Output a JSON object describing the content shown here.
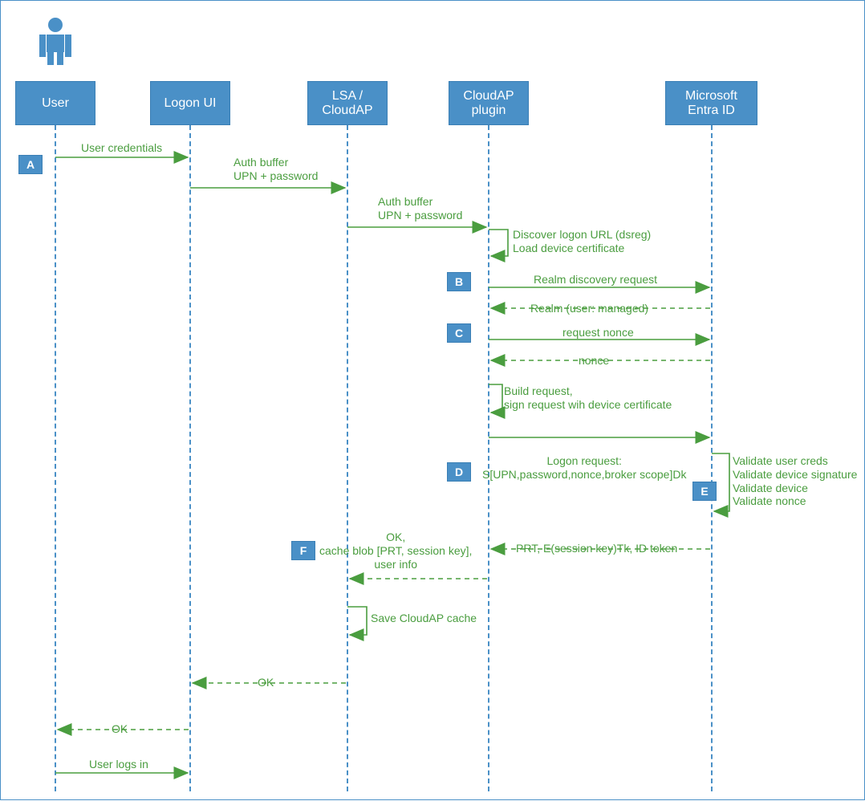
{
  "participants": {
    "user": "User",
    "logonui": "Logon UI",
    "lsa": "LSA / CloudAP",
    "plugin": "CloudAP plugin",
    "entra": "Microsoft Entra ID"
  },
  "steps": {
    "A": "A",
    "B": "B",
    "C": "C",
    "D": "D",
    "E": "E",
    "F": "F"
  },
  "messages": {
    "user_creds": "User credentials",
    "auth_buffer1": "Auth buffer\nUPN + password",
    "auth_buffer2": "Auth buffer\nUPN + password",
    "discover": "Discover logon URL (dsreg)\nLoad device certificate",
    "realm_req": "Realm discovery request",
    "realm_resp": "Realm (user: managed)",
    "req_nonce": "request nonce",
    "nonce": "nonce",
    "build_sign": "Build request,\nsign request wih device certificate",
    "logon_req": "Logon request:\nS[UPN,password,nonce,broker scope]Dk",
    "validate": "Validate user creds\nValidate device signature\nValidate device\nValidate nonce",
    "prt_resp": "PRT, E(session key)Tk, ID token",
    "cache_blob": "OK,\ncache blob [PRT, session key],\nuser info",
    "save_cache": "Save CloudAP cache",
    "ok1": "OK",
    "ok2": "OK",
    "logs_in": "User logs in"
  },
  "colors": {
    "blue": "#4a90c7",
    "green": "#4a9d3f"
  },
  "chart_data": {
    "type": "sequence-diagram",
    "participants": [
      "User",
      "Logon UI",
      "LSA / CloudAP",
      "CloudAP plugin",
      "Microsoft Entra ID"
    ],
    "steps": [
      {
        "tag": "A",
        "from": "User",
        "to": "Logon UI",
        "label": "User credentials",
        "style": "solid"
      },
      {
        "from": "Logon UI",
        "to": "LSA / CloudAP",
        "label": "Auth buffer UPN + password",
        "style": "solid"
      },
      {
        "from": "LSA / CloudAP",
        "to": "CloudAP plugin",
        "label": "Auth buffer UPN + password",
        "style": "solid"
      },
      {
        "from": "CloudAP plugin",
        "to": "CloudAP plugin",
        "label": "Discover logon URL (dsreg); Load device certificate",
        "style": "self"
      },
      {
        "tag": "B",
        "from": "CloudAP plugin",
        "to": "Microsoft Entra ID",
        "label": "Realm discovery request",
        "style": "solid"
      },
      {
        "from": "Microsoft Entra ID",
        "to": "CloudAP plugin",
        "label": "Realm (user: managed)",
        "style": "dashed"
      },
      {
        "tag": "C",
        "from": "CloudAP plugin",
        "to": "Microsoft Entra ID",
        "label": "request nonce",
        "style": "solid"
      },
      {
        "from": "Microsoft Entra ID",
        "to": "CloudAP plugin",
        "label": "nonce",
        "style": "dashed"
      },
      {
        "from": "CloudAP plugin",
        "to": "CloudAP plugin",
        "label": "Build request, sign request wih device certificate",
        "style": "self"
      },
      {
        "tag": "D",
        "from": "CloudAP plugin",
        "to": "Microsoft Entra ID",
        "label": "Logon request: S[UPN,password,nonce,broker scope]Dk",
        "style": "solid"
      },
      {
        "tag": "E",
        "from": "Microsoft Entra ID",
        "to": "Microsoft Entra ID",
        "label": "Validate user creds; Validate device signature; Validate device; Validate nonce",
        "style": "self"
      },
      {
        "from": "Microsoft Entra ID",
        "to": "CloudAP plugin",
        "label": "PRT, E(session key)Tk, ID token",
        "style": "dashed"
      },
      {
        "tag": "F",
        "from": "CloudAP plugin",
        "to": "LSA / CloudAP",
        "label": "OK, cache blob [PRT, session key], user info",
        "style": "dashed"
      },
      {
        "from": "LSA / CloudAP",
        "to": "LSA / CloudAP",
        "label": "Save CloudAP cache",
        "style": "self"
      },
      {
        "from": "LSA / CloudAP",
        "to": "Logon UI",
        "label": "OK",
        "style": "dashed"
      },
      {
        "from": "Logon UI",
        "to": "User",
        "label": "OK",
        "style": "dashed"
      },
      {
        "from": "User",
        "to": "Logon UI",
        "label": "User logs in",
        "style": "solid"
      }
    ]
  }
}
